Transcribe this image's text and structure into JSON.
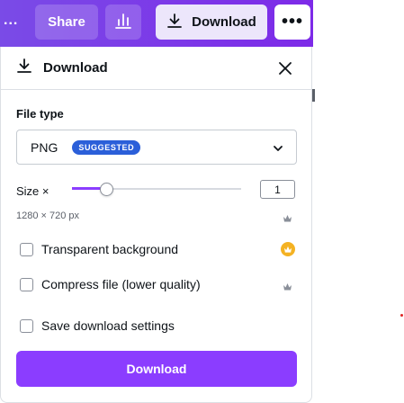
{
  "topbar": {
    "overflow_label": "...",
    "share_label": "Share",
    "insights_icon": "bar-chart-icon",
    "download_label": "Download",
    "download_icon": "download-icon",
    "more_label": "•••"
  },
  "panel": {
    "title": "Download",
    "title_icon": "download-icon",
    "close_icon": "close-icon",
    "file_type": {
      "label": "File type",
      "value": "PNG",
      "badge": "SUGGESTED"
    },
    "size": {
      "label": "Size ×",
      "value": "1",
      "slider_fraction": 0.2,
      "dimensions": "1280 × 720 px"
    },
    "options": [
      {
        "label": "Transparent background",
        "checked": false,
        "premium": "crown-gold-icon"
      },
      {
        "label": "Compress file (lower quality)",
        "checked": false,
        "premium": "crown-icon"
      },
      {
        "label": "Save download settings",
        "checked": false
      }
    ],
    "download_button": "Download"
  },
  "colors": {
    "accent": "#8b3dff",
    "topbar": "#7d2ae8",
    "badge": "#2b5fd9",
    "crown_gold": "#f4b223"
  }
}
